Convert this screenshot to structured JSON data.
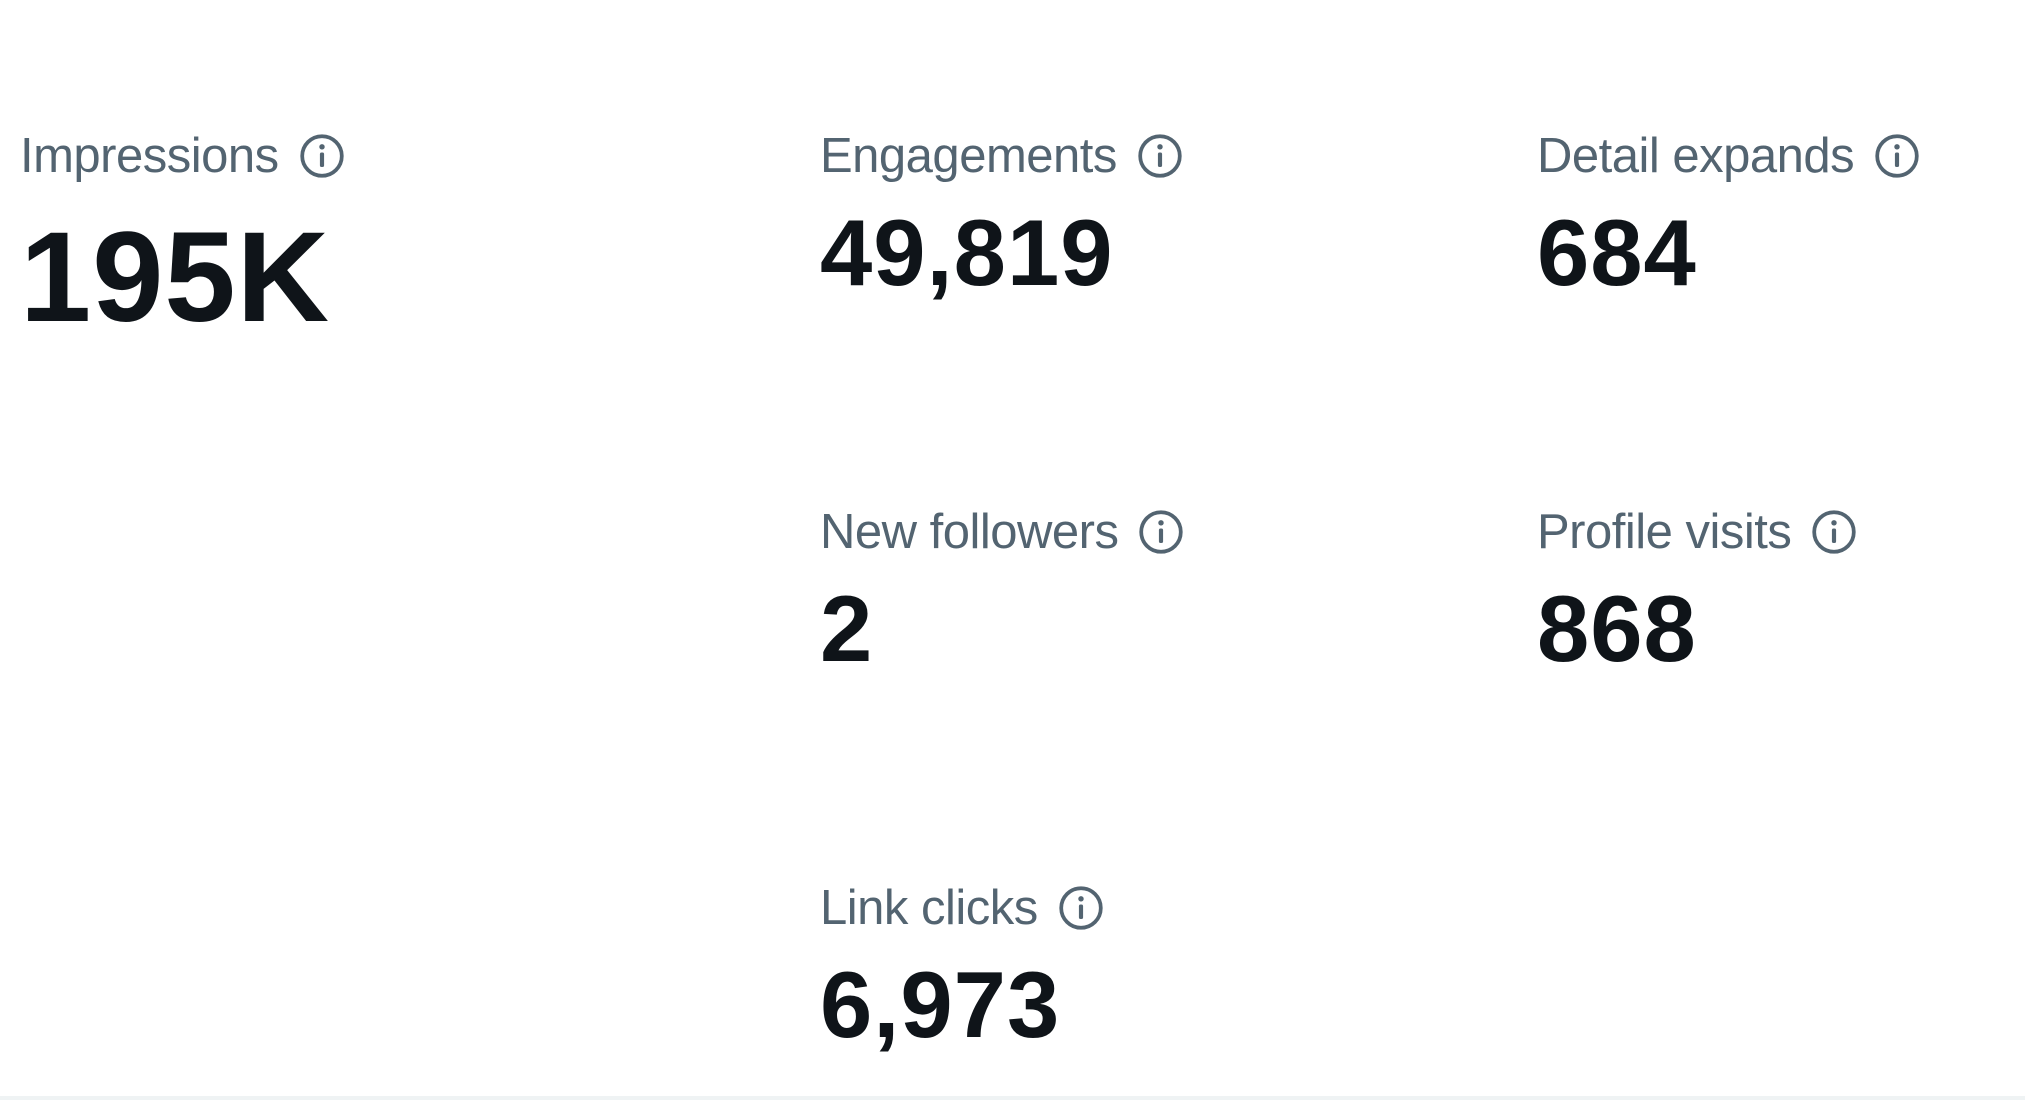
{
  "stats": {
    "impressions": {
      "label": "Impressions",
      "value": "195K",
      "icon": "info-icon"
    },
    "engagements": {
      "label": "Engagements",
      "value": "49,819",
      "icon": "info-icon"
    },
    "detail_expands": {
      "label": "Detail expands",
      "value": "684",
      "icon": "info-icon"
    },
    "new_followers": {
      "label": "New followers",
      "value": "2",
      "icon": "info-icon"
    },
    "profile_visits": {
      "label": "Profile visits",
      "value": "868",
      "icon": "info-icon"
    },
    "link_clicks": {
      "label": "Link clicks",
      "value": "6,973",
      "icon": "info-icon"
    }
  },
  "colors": {
    "label": "#536471",
    "value": "#0f1419",
    "background": "#ffffff"
  }
}
